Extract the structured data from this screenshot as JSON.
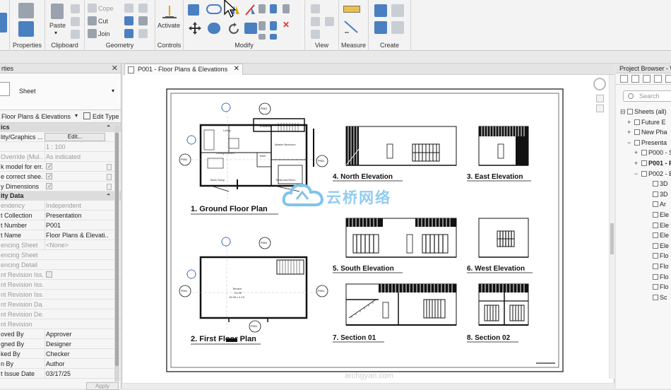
{
  "ribbon": {
    "panels": {
      "properties": "Properties",
      "clipboard": "Clipboard",
      "geometry": "Geometry",
      "controls": "Controls",
      "modify": "Modify",
      "view": "View",
      "measure": "Measure",
      "create": "Create"
    },
    "paste": "Paste",
    "cope": "Cope",
    "cut": "Cut",
    "join": "Join",
    "activate": "Activate"
  },
  "properties": {
    "title": "rties",
    "type_name": "Sheet",
    "filter": "Floor Plans & Elevations",
    "edit_type": "Edit Type",
    "groups": {
      "graphics": "ics",
      "identity": "ity Data"
    },
    "rows": [
      {
        "k": "lity/Graphics ...",
        "v": "Edit..."
      },
      {
        "k": "",
        "v": "1 : 100"
      },
      {
        "k": "Override (Mul...",
        "v": "As indicated"
      },
      {
        "k": "k model for err...",
        "v": ""
      },
      {
        "k": "e correct shee...",
        "v": ""
      },
      {
        "k": "y Dimensions",
        "v": ""
      }
    ],
    "identity_rows": [
      {
        "k": "endency",
        "v": "Independent"
      },
      {
        "k": "t Collection",
        "v": "Presentation"
      },
      {
        "k": "t Number",
        "v": "P001"
      },
      {
        "k": "t Name",
        "v": "Floor Plans & Elevati..."
      },
      {
        "k": "encing Sheet",
        "v": "<None>"
      },
      {
        "k": "encing Sheet",
        "v": ""
      },
      {
        "k": "encing Detail",
        "v": ""
      },
      {
        "k": "nt Revision Iss...",
        "v": ""
      },
      {
        "k": "nt Revision Iss...",
        "v": ""
      },
      {
        "k": "nt Revision Iss...",
        "v": ""
      },
      {
        "k": "nt Revision Da...",
        "v": ""
      },
      {
        "k": "nt Revision De...",
        "v": ""
      },
      {
        "k": "nt Revision",
        "v": ""
      },
      {
        "k": "oved By",
        "v": "Approver"
      },
      {
        "k": "gned By",
        "v": "Designer"
      },
      {
        "k": "ked By",
        "v": "Checker"
      },
      {
        "k": "n By",
        "v": "Author"
      },
      {
        "k": "t Issue Date",
        "v": "03/17/25"
      }
    ],
    "apply": "Apply"
  },
  "document": {
    "tab_label": "P001 - Floor Plans & Elevations",
    "views": {
      "ground": "1.  Ground Floor Plan",
      "first": "2.  First Floor Plan",
      "north": "4.  North Elevation",
      "east": "3.  East Elevation",
      "south": "5.  South Elevation",
      "west": "6.  West Elevation",
      "section1": "7.  Section 01",
      "section2": "8.  Section 02"
    },
    "rooms": {
      "living": "Living",
      "entrance": "Entrance",
      "dining": "Dining/Kitchen",
      "master": "Master Bedroom",
      "toilet": "Toilet",
      "back_stoop": "Back Stoop",
      "bedroom": "Bedroom/Shed",
      "terrace": "Terrace",
      "terrace_area": "714 ft²",
      "terrace_dims": "15.95 x 4.19"
    },
    "tags": {
      "p001": "P001"
    }
  },
  "browser": {
    "title": "Project Browser - W",
    "search_placeholder": "Search",
    "tree": [
      {
        "label": "Sheets (all)",
        "exp": "⊟",
        "indent": 0,
        "bold": false
      },
      {
        "label": "Future E",
        "exp": "+",
        "indent": 10,
        "bold": false
      },
      {
        "label": "New Pha",
        "exp": "+",
        "indent": 10,
        "bold": false
      },
      {
        "label": "Presenta",
        "exp": "−",
        "indent": 10,
        "bold": false
      },
      {
        "label": "P000 - St",
        "exp": "+",
        "indent": 20,
        "bold": false
      },
      {
        "label": "P001 - Fl",
        "exp": "+",
        "indent": 20,
        "bold": true
      },
      {
        "label": "P002 - Ex",
        "exp": "−",
        "indent": 20,
        "bold": false
      },
      {
        "label": "3D",
        "exp": "",
        "indent": 36,
        "bold": false
      },
      {
        "label": "3D",
        "exp": "",
        "indent": 36,
        "bold": false
      },
      {
        "label": "Ar",
        "exp": "",
        "indent": 36,
        "bold": false
      },
      {
        "label": "Ele",
        "exp": "",
        "indent": 36,
        "bold": false
      },
      {
        "label": "Ele",
        "exp": "",
        "indent": 36,
        "bold": false
      },
      {
        "label": "Ele",
        "exp": "",
        "indent": 36,
        "bold": false
      },
      {
        "label": "Ele",
        "exp": "",
        "indent": 36,
        "bold": false
      },
      {
        "label": "Flo",
        "exp": "",
        "indent": 36,
        "bold": false
      },
      {
        "label": "Flo",
        "exp": "",
        "indent": 36,
        "bold": false
      },
      {
        "label": "Flo",
        "exp": "",
        "indent": 36,
        "bold": false
      },
      {
        "label": "Flo",
        "exp": "",
        "indent": 36,
        "bold": false
      },
      {
        "label": "Sc",
        "exp": "",
        "indent": 36,
        "bold": false
      }
    ]
  },
  "watermark": {
    "text": "云桥网络",
    "bottom": "archgyan.com"
  },
  "colors": {
    "accent": "#4a7fc1",
    "watermark": "#7fc4ee"
  }
}
